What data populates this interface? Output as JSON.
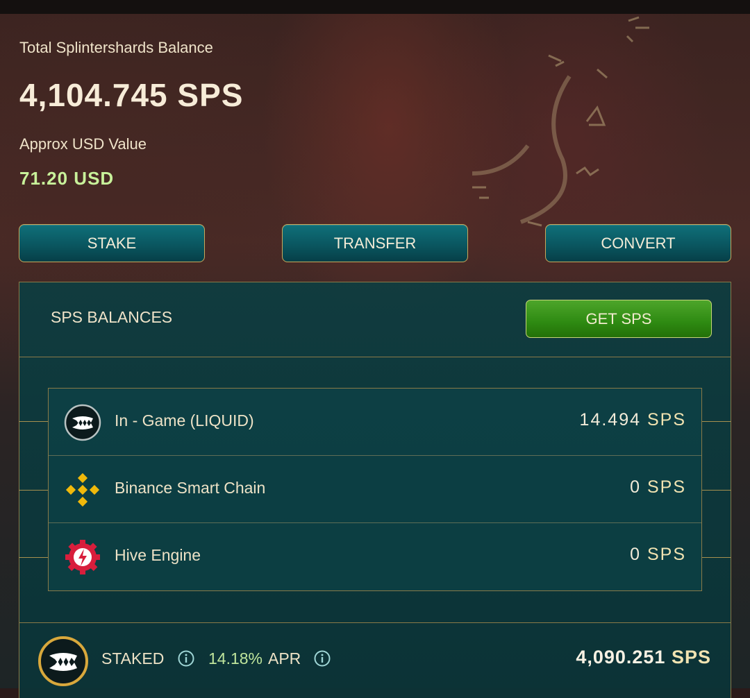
{
  "balance": {
    "label": "Total Splintershards Balance",
    "total": "4,104.745 SPS",
    "usd_label": "Approx USD Value",
    "usd_value": "71.20 USD"
  },
  "actions": {
    "stake": "STAKE",
    "transfer": "TRANSFER",
    "convert": "CONVERT"
  },
  "panel": {
    "title": "SPS BALANCES",
    "get_button": "GET SPS"
  },
  "balances": [
    {
      "icon": "splinterlands-fang-icon",
      "name": "In - Game (LIQUID)",
      "amount": "14.494",
      "unit": "SPS"
    },
    {
      "icon": "binance-icon",
      "name": "Binance Smart Chain",
      "amount": "0",
      "unit": "SPS"
    },
    {
      "icon": "hive-engine-icon",
      "name": "Hive Engine",
      "amount": "0",
      "unit": "SPS"
    }
  ],
  "staked": {
    "icon": "splinterlands-fang-icon",
    "label": "STAKED",
    "apr_value": "14.18%",
    "apr_label": "APR",
    "amount": "4,090.251",
    "unit": "SPS"
  },
  "colors": {
    "button_teal": "#0a5660",
    "button_green": "#2e8a12",
    "gold_border": "#c9a85b",
    "usd_green": "#c8f19a"
  }
}
